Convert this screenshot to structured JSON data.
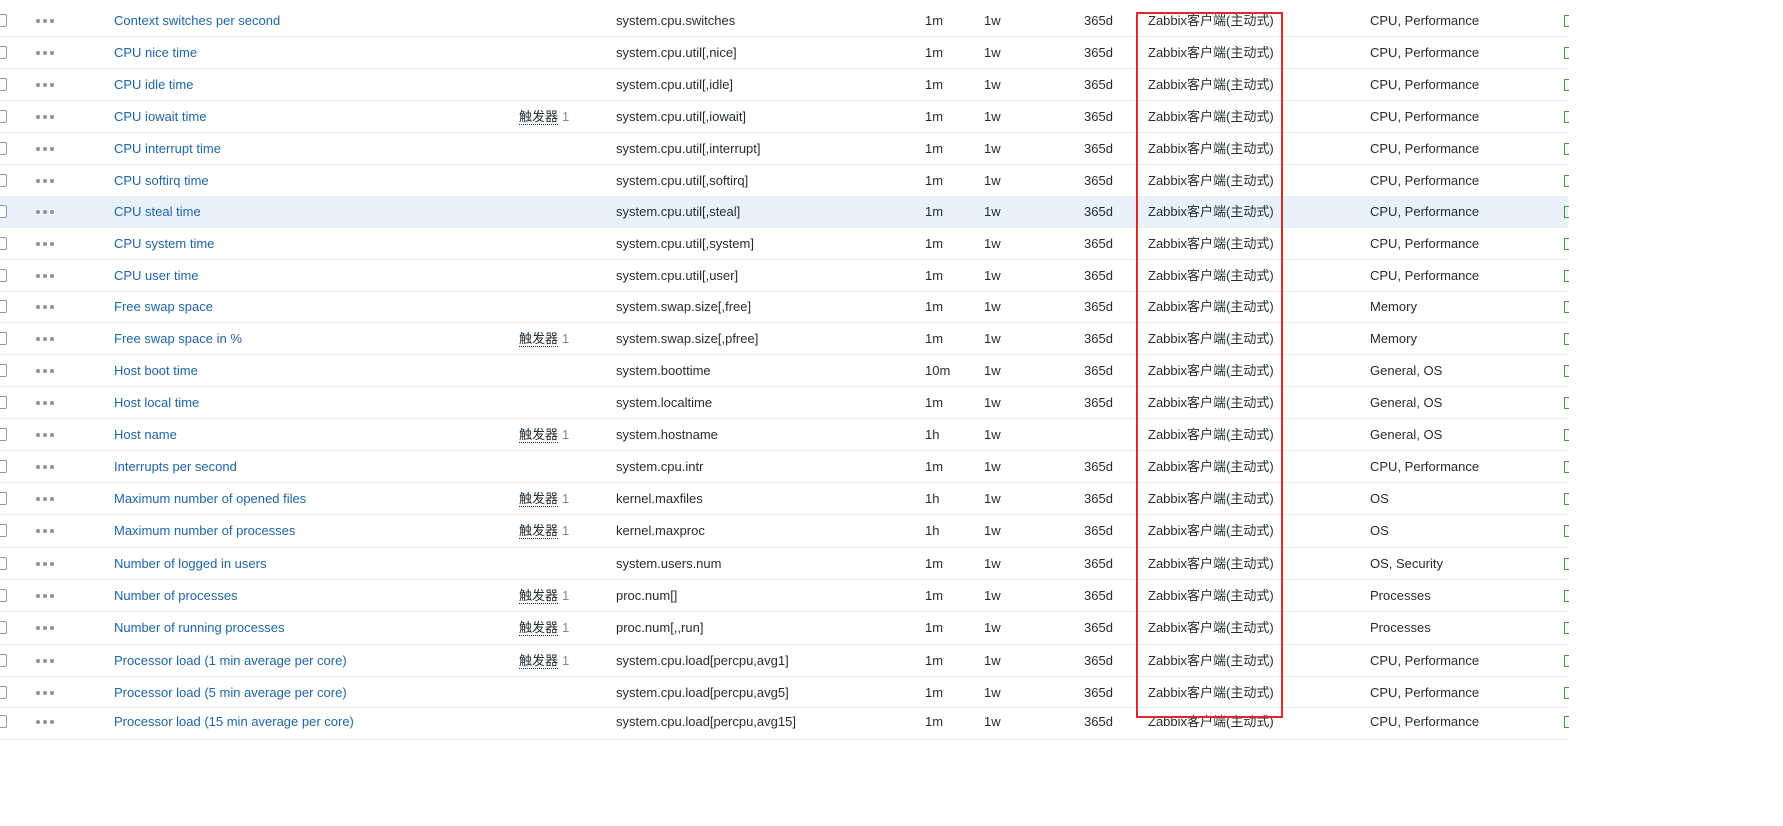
{
  "colors": {
    "link": "#1f65a6",
    "text": "#1f2c33",
    "muted": "#768d99",
    "row_highlight": "#e9f2fb",
    "annotation": "#e3262a"
  },
  "icons": {
    "row_menu": "ellipsis-menu-icon",
    "row_select": "checkbox",
    "tag_edge": "tag-icon"
  },
  "rows": [
    {
      "name": "Context switches per second",
      "triggers_label": "",
      "triggers_count": "",
      "key": "system.cpu.switches",
      "interval": "1m",
      "history": "1w",
      "trends": "365d",
      "type": "Zabbix客户端(主动式)",
      "tags": "CPU, Performance"
    },
    {
      "name": "CPU nice time",
      "triggers_label": "",
      "triggers_count": "",
      "key": "system.cpu.util[,nice]",
      "interval": "1m",
      "history": "1w",
      "trends": "365d",
      "type": "Zabbix客户端(主动式)",
      "tags": "CPU, Performance"
    },
    {
      "name": "CPU idle time",
      "triggers_label": "",
      "triggers_count": "",
      "key": "system.cpu.util[,idle]",
      "interval": "1m",
      "history": "1w",
      "trends": "365d",
      "type": "Zabbix客户端(主动式)",
      "tags": "CPU, Performance"
    },
    {
      "name": "CPU iowait time",
      "triggers_label": "触发器",
      "triggers_count": "1",
      "key": "system.cpu.util[,iowait]",
      "interval": "1m",
      "history": "1w",
      "trends": "365d",
      "type": "Zabbix客户端(主动式)",
      "tags": "CPU, Performance"
    },
    {
      "name": "CPU interrupt time",
      "triggers_label": "",
      "triggers_count": "",
      "key": "system.cpu.util[,interrupt]",
      "interval": "1m",
      "history": "1w",
      "trends": "365d",
      "type": "Zabbix客户端(主动式)",
      "tags": "CPU, Performance"
    },
    {
      "name": "CPU softirq time",
      "triggers_label": "",
      "triggers_count": "",
      "key": "system.cpu.util[,softirq]",
      "interval": "1m",
      "history": "1w",
      "trends": "365d",
      "type": "Zabbix客户端(主动式)",
      "tags": "CPU, Performance"
    },
    {
      "name": "CPU steal time",
      "triggers_label": "",
      "triggers_count": "",
      "key": "system.cpu.util[,steal]",
      "interval": "1m",
      "history": "1w",
      "trends": "365d",
      "type": "Zabbix客户端(主动式)",
      "tags": "CPU, Performance",
      "highlighted": true
    },
    {
      "name": "CPU system time",
      "triggers_label": "",
      "triggers_count": "",
      "key": "system.cpu.util[,system]",
      "interval": "1m",
      "history": "1w",
      "trends": "365d",
      "type": "Zabbix客户端(主动式)",
      "tags": "CPU, Performance"
    },
    {
      "name": "CPU user time",
      "triggers_label": "",
      "triggers_count": "",
      "key": "system.cpu.util[,user]",
      "interval": "1m",
      "history": "1w",
      "trends": "365d",
      "type": "Zabbix客户端(主动式)",
      "tags": "CPU, Performance"
    },
    {
      "name": "Free swap space",
      "triggers_label": "",
      "triggers_count": "",
      "key": "system.swap.size[,free]",
      "interval": "1m",
      "history": "1w",
      "trends": "365d",
      "type": "Zabbix客户端(主动式)",
      "tags": "Memory"
    },
    {
      "name": "Free swap space in %",
      "triggers_label": "触发器",
      "triggers_count": "1",
      "key": "system.swap.size[,pfree]",
      "interval": "1m",
      "history": "1w",
      "trends": "365d",
      "type": "Zabbix客户端(主动式)",
      "tags": "Memory"
    },
    {
      "name": "Host boot time",
      "triggers_label": "",
      "triggers_count": "",
      "key": "system.boottime",
      "interval": "10m",
      "history": "1w",
      "trends": "365d",
      "type": "Zabbix客户端(主动式)",
      "tags": "General, OS"
    },
    {
      "name": "Host local time",
      "triggers_label": "",
      "triggers_count": "",
      "key": "system.localtime",
      "interval": "1m",
      "history": "1w",
      "trends": "365d",
      "type": "Zabbix客户端(主动式)",
      "tags": "General, OS"
    },
    {
      "name": "Host name",
      "triggers_label": "触发器",
      "triggers_count": "1",
      "key": "system.hostname",
      "interval": "1h",
      "history": "1w",
      "trends": "",
      "type": "Zabbix客户端(主动式)",
      "tags": "General, OS"
    },
    {
      "name": "Interrupts per second",
      "triggers_label": "",
      "triggers_count": "",
      "key": "system.cpu.intr",
      "interval": "1m",
      "history": "1w",
      "trends": "365d",
      "type": "Zabbix客户端(主动式)",
      "tags": "CPU, Performance"
    },
    {
      "name": "Maximum number of opened files",
      "triggers_label": "触发器",
      "triggers_count": "1",
      "key": "kernel.maxfiles",
      "interval": "1h",
      "history": "1w",
      "trends": "365d",
      "type": "Zabbix客户端(主动式)",
      "tags": "OS"
    },
    {
      "name": "Maximum number of processes",
      "triggers_label": "触发器",
      "triggers_count": "1",
      "key": "kernel.maxproc",
      "interval": "1h",
      "history": "1w",
      "trends": "365d",
      "type": "Zabbix客户端(主动式)",
      "tags": "OS"
    },
    {
      "name": "Number of logged in users",
      "triggers_label": "",
      "triggers_count": "",
      "key": "system.users.num",
      "interval": "1m",
      "history": "1w",
      "trends": "365d",
      "type": "Zabbix客户端(主动式)",
      "tags": "OS, Security"
    },
    {
      "name": "Number of processes",
      "triggers_label": "触发器",
      "triggers_count": "1",
      "key": "proc.num[]",
      "interval": "1m",
      "history": "1w",
      "trends": "365d",
      "type": "Zabbix客户端(主动式)",
      "tags": "Processes"
    },
    {
      "name": "Number of running processes",
      "triggers_label": "触发器",
      "triggers_count": "1",
      "key": "proc.num[,,run]",
      "interval": "1m",
      "history": "1w",
      "trends": "365d",
      "type": "Zabbix客户端(主动式)",
      "tags": "Processes"
    },
    {
      "name": "Processor load (1 min average per core)",
      "triggers_label": "触发器",
      "triggers_count": "1",
      "key": "system.cpu.load[percpu,avg1]",
      "interval": "1m",
      "history": "1w",
      "trends": "365d",
      "type": "Zabbix客户端(主动式)",
      "tags": "CPU, Performance"
    },
    {
      "name": "Processor load (5 min average per core)",
      "triggers_label": "",
      "triggers_count": "",
      "key": "system.cpu.load[percpu,avg5]",
      "interval": "1m",
      "history": "1w",
      "trends": "365d",
      "type": "Zabbix客户端(主动式)",
      "tags": "CPU, Performance"
    },
    {
      "name": "Processor load (15 min average per core)",
      "triggers_label": "",
      "triggers_count": "",
      "key": "system.cpu.load[percpu,avg15]",
      "interval": "1m",
      "history": "1w",
      "trends": "365d",
      "type": "Zabbix客户端(主动式)",
      "tags": "CPU, Performance"
    }
  ]
}
